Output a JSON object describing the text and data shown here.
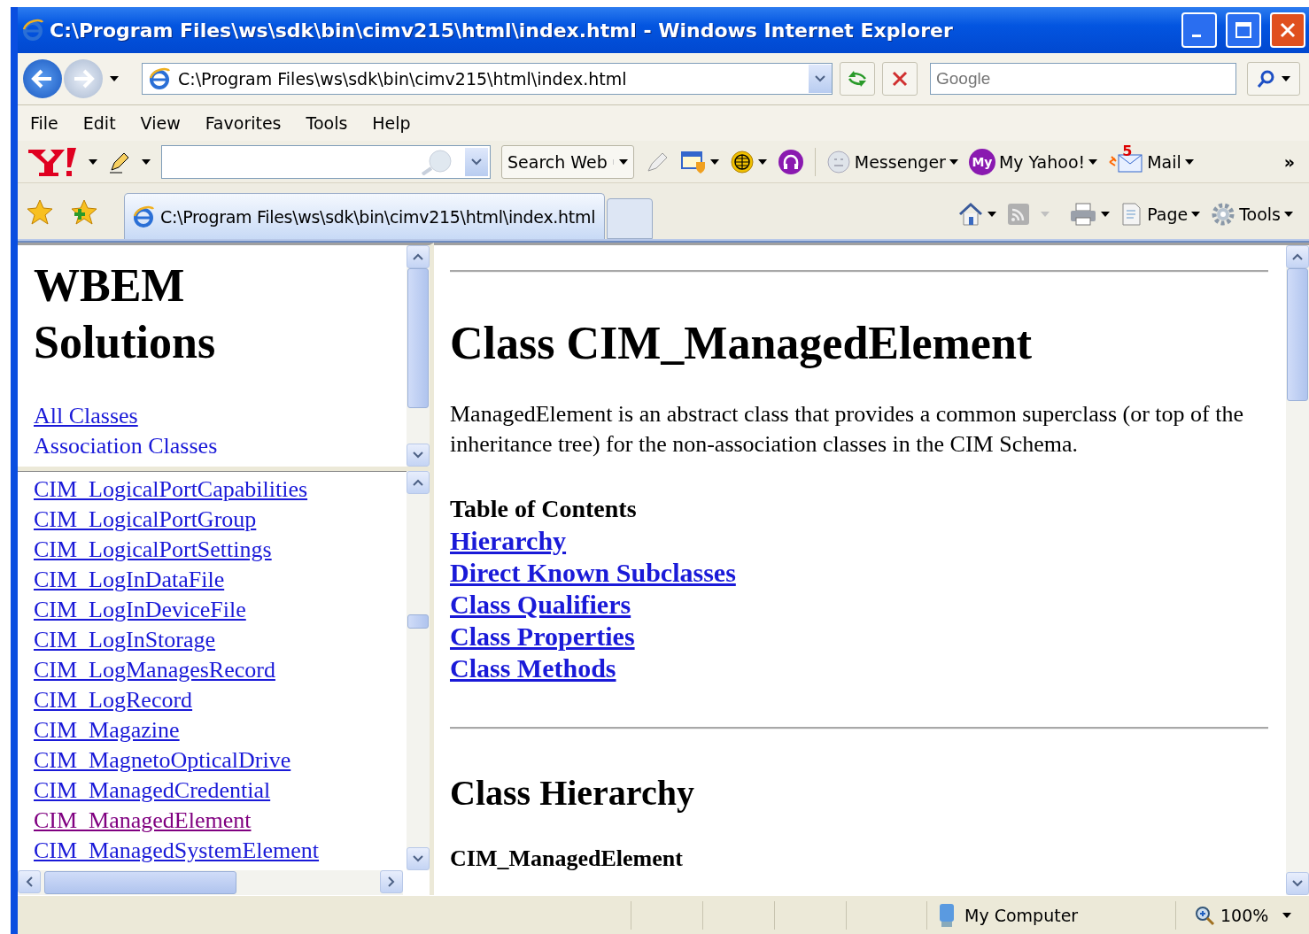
{
  "window": {
    "title": "C:\\Program Files\\ws\\sdk\\bin\\cimv215\\html\\index.html - Windows Internet Explorer"
  },
  "address_bar": {
    "value": "C:\\Program Files\\ws\\sdk\\bin\\cimv215\\html\\index.html"
  },
  "search": {
    "placeholder": "Google"
  },
  "menu": [
    "File",
    "Edit",
    "View",
    "Favorites",
    "Tools",
    "Help"
  ],
  "yahoo_toolbar": {
    "search_button": "Search Web",
    "items": [
      {
        "kind": "messenger",
        "label": "Messenger"
      },
      {
        "kind": "myyahoo",
        "label": "My Yahoo!",
        "icon_text": "My"
      },
      {
        "kind": "mail",
        "label": "Mail",
        "badge": "5"
      }
    ],
    "more": "»"
  },
  "tab": {
    "title": "C:\\Program Files\\ws\\sdk\\bin\\cimv215\\html\\index.html"
  },
  "command_bar": [
    {
      "kind": "page",
      "label": "Page"
    },
    {
      "kind": "tools",
      "label": "Tools"
    }
  ],
  "header_frame": {
    "title": "WBEM Solutions",
    "links": [
      {
        "label": "All Classes",
        "underlined": true
      },
      {
        "label": "Association Classes",
        "underlined": false
      }
    ]
  },
  "class_list": [
    {
      "name": "CIM_LogicalPortCapabilities",
      "visited": false
    },
    {
      "name": "CIM_LogicalPortGroup",
      "visited": false
    },
    {
      "name": "CIM_LogicalPortSettings",
      "visited": false
    },
    {
      "name": "CIM_LogInDataFile",
      "visited": false
    },
    {
      "name": "CIM_LogInDeviceFile",
      "visited": false
    },
    {
      "name": "CIM_LogInStorage",
      "visited": false
    },
    {
      "name": "CIM_LogManagesRecord",
      "visited": false
    },
    {
      "name": "CIM_LogRecord",
      "visited": false
    },
    {
      "name": "CIM_Magazine",
      "visited": false
    },
    {
      "name": "CIM_MagnetoOpticalDrive",
      "visited": false
    },
    {
      "name": "CIM_ManagedCredential",
      "visited": false
    },
    {
      "name": "CIM_ManagedElement",
      "visited": true
    },
    {
      "name": "CIM_ManagedSystemElement",
      "visited": false
    }
  ],
  "content": {
    "title": "Class CIM_ManagedElement",
    "description": "ManagedElement is an abstract class that provides a common superclass (or top of the inheritance tree) for the non-association classes in the CIM Schema.",
    "toc_heading": "Table of Contents",
    "toc": [
      "Hierarchy",
      "Direct Known Subclasses",
      "Class Qualifiers",
      "Class Properties",
      "Class Methods"
    ],
    "section_heading": "Class Hierarchy",
    "hierarchy_root": "CIM_ManagedElement"
  },
  "status_bar": {
    "zone": "My Computer",
    "zoom": "100%"
  }
}
